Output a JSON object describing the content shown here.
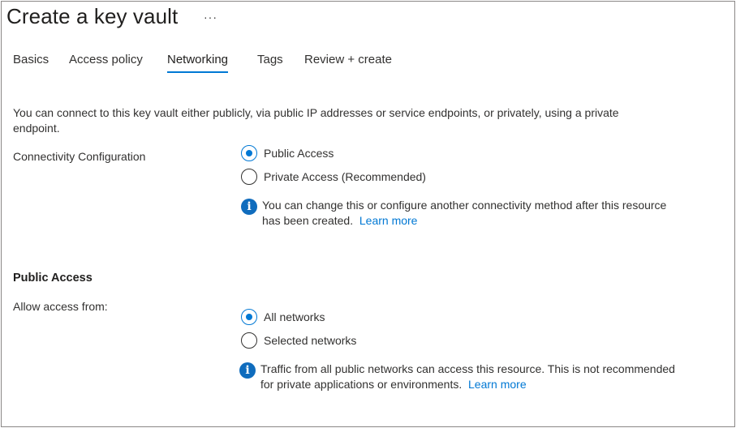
{
  "page": {
    "title": "Create a key vault",
    "more_icon": "ellipsis-icon"
  },
  "tabs": [
    {
      "label": "Basics",
      "active": false
    },
    {
      "label": "Access policy",
      "active": false
    },
    {
      "label": "Networking",
      "active": true
    },
    {
      "label": "Tags",
      "active": false
    },
    {
      "label": "Review + create",
      "active": false
    }
  ],
  "networking": {
    "intro_line1": "You can connect to this key vault either publicly, via public IP addresses or service endpoints, or privately, using a private",
    "intro_line2": "endpoint.",
    "connectivity": {
      "label": "Connectivity Configuration",
      "options": [
        {
          "label": "Public Access",
          "checked": true
        },
        {
          "label": "Private Access (Recommended)",
          "checked": false
        }
      ],
      "info_icon": "info-icon",
      "info_line1": "You can change this or configure another connectivity method after this resource",
      "info_line2": "has been created.",
      "learn_more": "Learn more"
    },
    "public_access": {
      "heading": "Public Access",
      "allow_label": "Allow access from:",
      "options": [
        {
          "label": "All networks",
          "checked": true
        },
        {
          "label": "Selected networks",
          "checked": false
        }
      ],
      "info_icon": "info-icon",
      "info_line1": "Traffic from all public networks can access this resource. This is not recommended",
      "info_line2": "for private applications or environments.",
      "learn_more": "Learn more"
    }
  },
  "colors": {
    "accent": "#0078d4",
    "text": "#323130",
    "border": "#8a8886"
  }
}
